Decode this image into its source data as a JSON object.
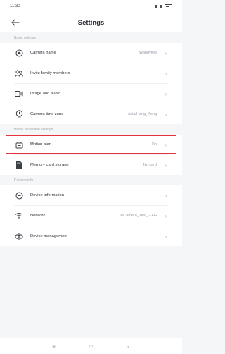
{
  "status_bar": {
    "time": "11:30"
  },
  "header": {
    "title": "Settings"
  },
  "sections": {
    "basic": {
      "title": "Basic settings",
      "items": [
        {
          "label": "Camera name",
          "value": "Wandview",
          "icon": "camera-icon"
        },
        {
          "label": "Invite family members",
          "value": "",
          "icon": "family-icon"
        },
        {
          "label": "Image and audio",
          "value": "",
          "icon": "image-audio-icon"
        },
        {
          "label": "Camera time zone",
          "value": "Asia/Hong_Kong",
          "icon": "clock-icon"
        }
      ]
    },
    "home_protection": {
      "title": "Home protection settings",
      "items": [
        {
          "label": "Motion alert",
          "value": "On",
          "icon": "motion-icon"
        },
        {
          "label": "Memory card storage",
          "value": "No card",
          "icon": "sd-card-icon"
        }
      ]
    },
    "camera_info": {
      "title": "Camera info",
      "items": [
        {
          "label": "Device information",
          "value": "",
          "icon": "info-icon"
        },
        {
          "label": "Network",
          "value": "IPCamera_Test_2.4G",
          "icon": "wifi-icon"
        },
        {
          "label": "Device management",
          "value": "",
          "icon": "management-icon"
        }
      ]
    }
  },
  "nav_bar": {
    "menu": "≡",
    "home": "□",
    "back": "‹"
  }
}
